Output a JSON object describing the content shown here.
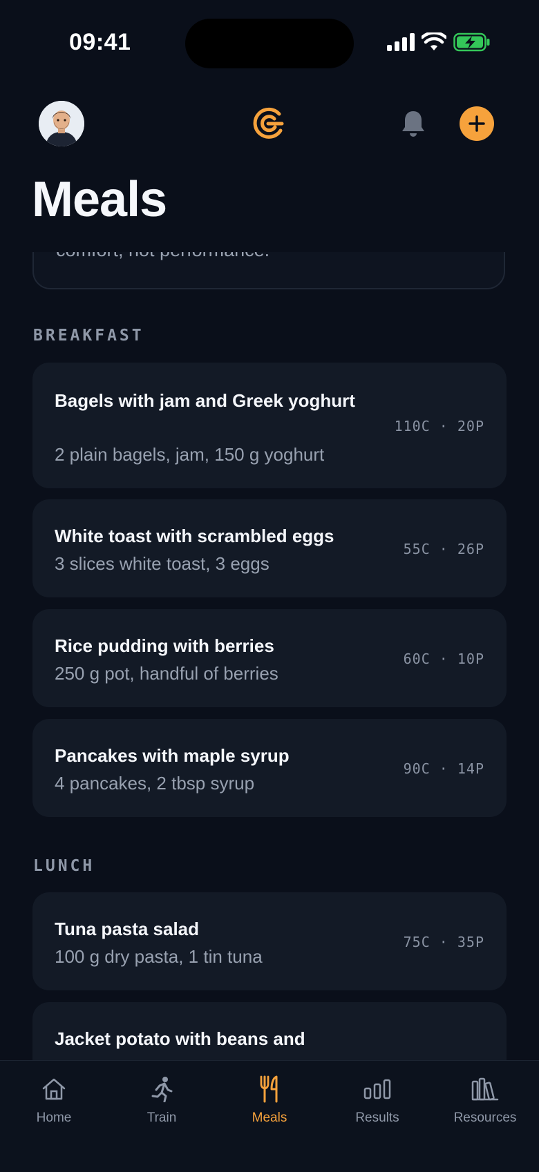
{
  "status": {
    "time": "09:41"
  },
  "page": {
    "title": "Meals"
  },
  "intro": {
    "text_visible": "comfort, not performance."
  },
  "sections": [
    {
      "label": "BREAKFAST",
      "meals": [
        {
          "name": "Bagels with jam and Greek yoghurt",
          "desc": "2 plain bagels, jam, 150 g yoghurt",
          "macros": "110C · 20P"
        },
        {
          "name": "White toast with scrambled eggs",
          "desc": "3 slices white toast, 3 eggs",
          "macros": "55C · 26P"
        },
        {
          "name": "Rice pudding with berries",
          "desc": "250 g pot, handful of berries",
          "macros": "60C · 10P"
        },
        {
          "name": "Pancakes with maple syrup",
          "desc": "4 pancakes, 2 tbsp syrup",
          "macros": "90C · 14P"
        }
      ]
    },
    {
      "label": "LUNCH",
      "meals": [
        {
          "name": "Tuna pasta salad",
          "desc": "100 g dry pasta, 1 tin tuna",
          "macros": "75C · 35P"
        },
        {
          "name": "Jacket potato with beans and",
          "desc": "",
          "macros": ""
        }
      ]
    }
  ],
  "nav": [
    {
      "label": "Home",
      "icon": "home-icon"
    },
    {
      "label": "Train",
      "icon": "runner-icon"
    },
    {
      "label": "Meals",
      "icon": "fork-knife-icon",
      "active": true
    },
    {
      "label": "Results",
      "icon": "bar-chart-icon"
    },
    {
      "label": "Resources",
      "icon": "books-icon"
    }
  ],
  "colors": {
    "accent": "#f6a23c",
    "background": "#0a0f1a",
    "card": "#131a26",
    "battery": "#34c759"
  }
}
